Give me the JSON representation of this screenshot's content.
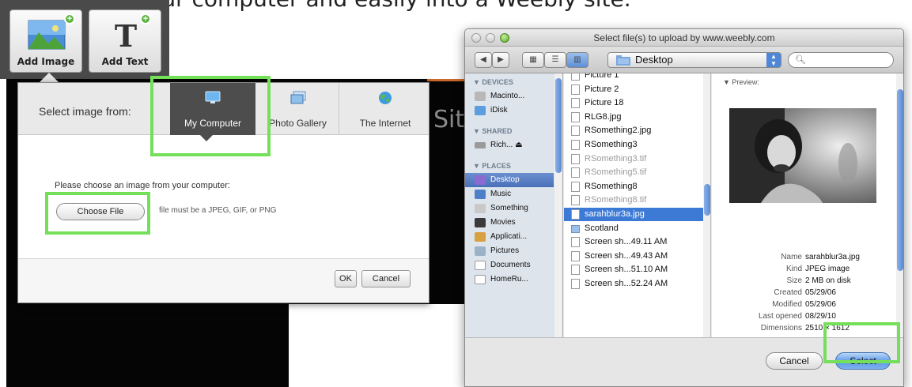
{
  "caption": "Image from your computer and easily into a Weebly site.",
  "editor": {
    "toolbar": {
      "add_image": "Add Image",
      "add_text": "Add Text"
    },
    "site_text": "Site",
    "image_dialog": {
      "select_from": "Select image from:",
      "tabs": [
        {
          "label": "My Computer",
          "active": true
        },
        {
          "label": "Photo Gallery",
          "active": false
        },
        {
          "label": "The Internet",
          "active": false
        }
      ],
      "prompt": "Please choose an image from your computer:",
      "choose_button": "Choose File",
      "hint": "file must be a JPEG, GIF, or PNG",
      "ok": "OK",
      "cancel": "Cancel"
    }
  },
  "file_dialog": {
    "title": "Select file(s) to upload by www.weebly.com",
    "location": "Desktop",
    "sidebar": {
      "devices_heading": "▼ DEVICES",
      "devices": [
        "Macinto...",
        "iDisk"
      ],
      "shared_heading": "▼ SHARED",
      "shared": [
        "Rich...  ⏏"
      ],
      "places_heading": "▼ PLACES",
      "places": [
        "Desktop",
        "Music",
        "Something",
        "Movies",
        "Applicati...",
        "Pictures",
        "Documents",
        "HomeRu..."
      ]
    },
    "files": [
      {
        "name": "Picture 1",
        "state": "normal"
      },
      {
        "name": "Picture 2",
        "state": "normal"
      },
      {
        "name": "Picture 18",
        "state": "normal"
      },
      {
        "name": "RLG8.jpg",
        "state": "normal"
      },
      {
        "name": "RSomething2.jpg",
        "state": "normal"
      },
      {
        "name": "RSomething3",
        "state": "normal"
      },
      {
        "name": "RSomething3.tif",
        "state": "dim"
      },
      {
        "name": "RSomething5.tif",
        "state": "dim"
      },
      {
        "name": "RSomething8",
        "state": "normal"
      },
      {
        "name": "RSomething8.tif",
        "state": "dim"
      },
      {
        "name": "sarahblur3a.jpg",
        "state": "selected"
      },
      {
        "name": "Scotland",
        "state": "folder"
      },
      {
        "name": "Screen sh...49.11 AM",
        "state": "normal"
      },
      {
        "name": "Screen sh...49.43 AM",
        "state": "normal"
      },
      {
        "name": "Screen sh...51.10 AM",
        "state": "normal"
      },
      {
        "name": "Screen sh...52.24 AM",
        "state": "normal"
      }
    ],
    "preview": {
      "label": "▼ Preview:",
      "meta": [
        {
          "key": "Name",
          "value": "sarahblur3a.jpg"
        },
        {
          "key": "Kind",
          "value": "JPEG image"
        },
        {
          "key": "Size",
          "value": "2 MB on disk"
        },
        {
          "key": "Created",
          "value": "05/29/06"
        },
        {
          "key": "Modified",
          "value": "05/29/06"
        },
        {
          "key": "Last opened",
          "value": "08/29/10"
        },
        {
          "key": "Dimensions",
          "value": "2510 × 1612"
        }
      ]
    },
    "cancel": "Cancel",
    "select": "Select"
  },
  "colors": {
    "highlight_green": "#74e05a",
    "selection_blue": "#3d7ad6",
    "dark_tab": "#4d4d4d"
  }
}
